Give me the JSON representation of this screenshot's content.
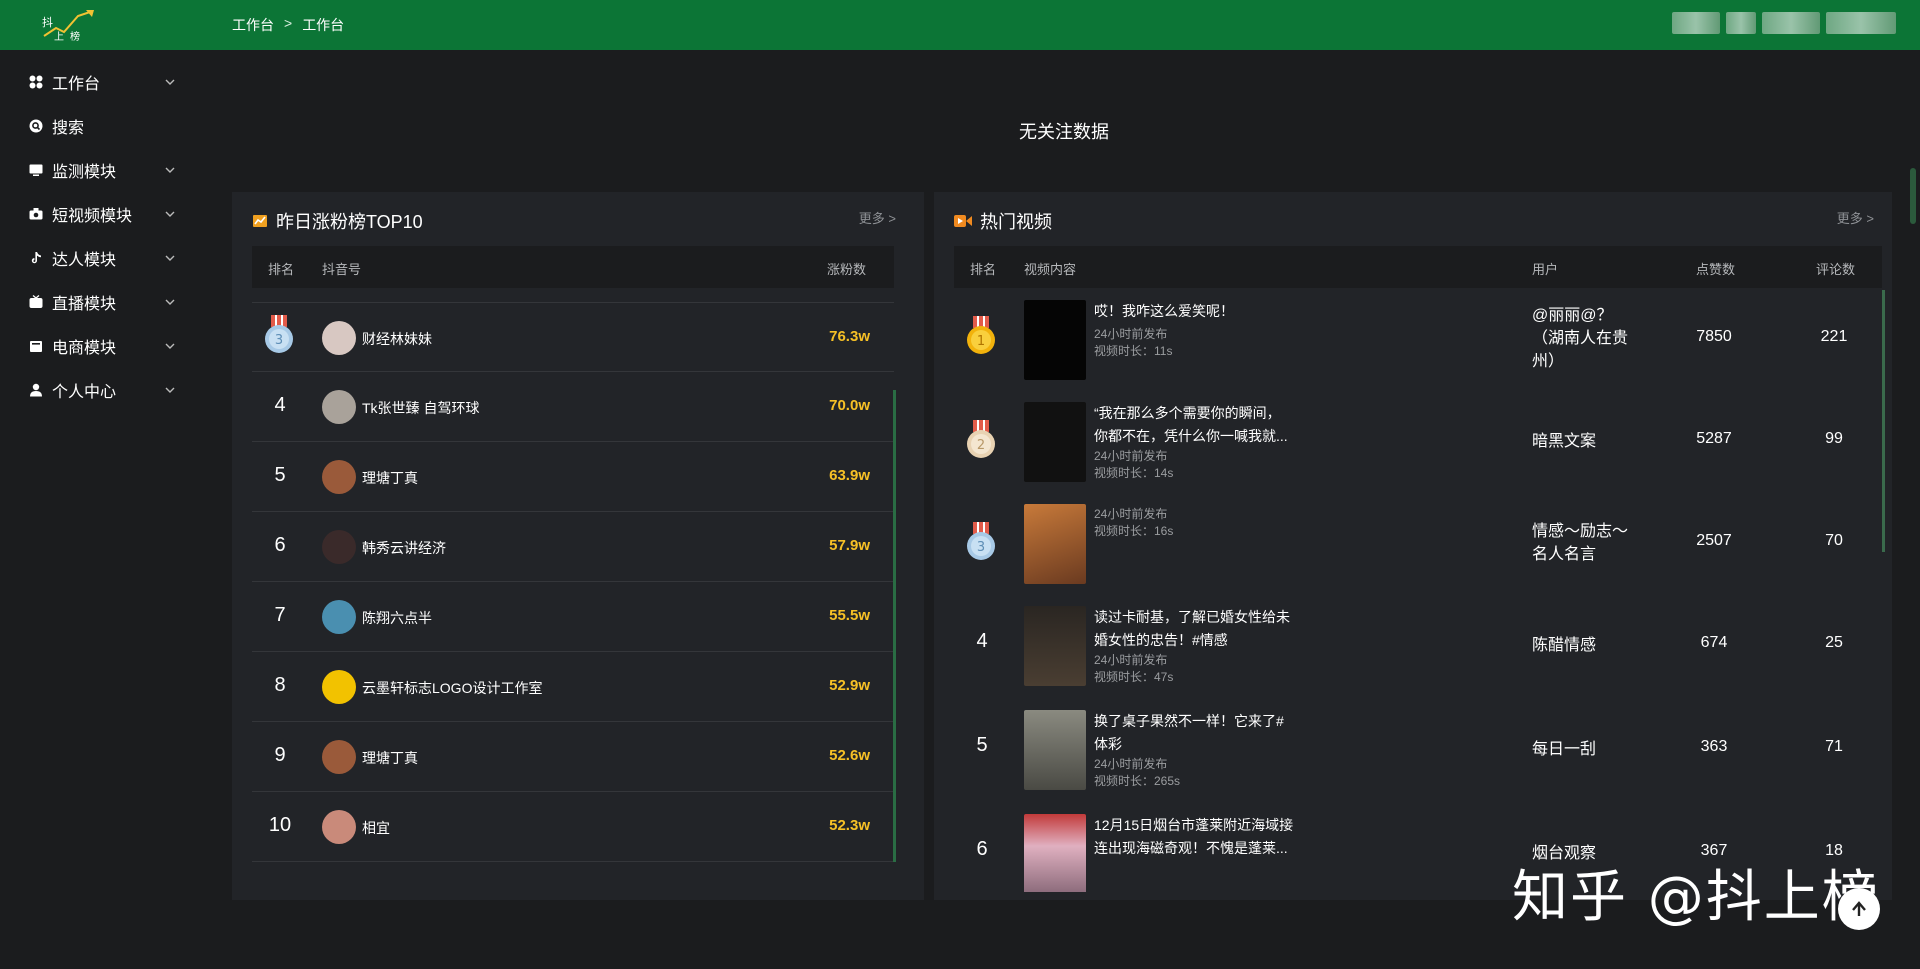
{
  "header": {
    "logo_text": "抖上榜",
    "breadcrumb": [
      "工作台",
      "工作台"
    ],
    "breadcrumb_sep": ">"
  },
  "sidebar": {
    "items": [
      {
        "label": "工作台",
        "icon": "dashboard-icon",
        "has_arrow": true
      },
      {
        "label": "搜索",
        "icon": "search-icon",
        "has_arrow": false
      },
      {
        "label": "监测模块",
        "icon": "monitor-icon",
        "has_arrow": true
      },
      {
        "label": "短视频模块",
        "icon": "camera-icon",
        "has_arrow": true
      },
      {
        "label": "达人模块",
        "icon": "tiktok-icon",
        "has_arrow": true
      },
      {
        "label": "直播模块",
        "icon": "tv-icon",
        "has_arrow": true
      },
      {
        "label": "电商模块",
        "icon": "shop-icon",
        "has_arrow": true
      },
      {
        "label": "个人中心",
        "icon": "user-icon",
        "has_arrow": true
      }
    ]
  },
  "main": {
    "empty_message": "无关注数据"
  },
  "fans_panel": {
    "title": "昨日涨粉榜TOP10",
    "more": "更多 >",
    "headers": {
      "rank": "排名",
      "account": "抖音号",
      "gain": "涨粉数"
    },
    "rows": [
      {
        "rank": "3",
        "medal": true,
        "name": "财经林妹妹",
        "gain": "76.3w",
        "avatar_color": "#d8c8c2"
      },
      {
        "rank": "4",
        "medal": false,
        "name": "Tk张世臻 自驾环球",
        "gain": "70.0w",
        "avatar_color": "#a9a29a"
      },
      {
        "rank": "5",
        "medal": false,
        "name": "理塘丁真",
        "gain": "63.9w",
        "avatar_color": "#9a5a3a"
      },
      {
        "rank": "6",
        "medal": false,
        "name": "韩秀云讲经济",
        "gain": "57.9w",
        "avatar_color": "#3a2a2a"
      },
      {
        "rank": "7",
        "medal": false,
        "name": "陈翔六点半",
        "gain": "55.5w",
        "avatar_color": "#4a8fb0"
      },
      {
        "rank": "8",
        "medal": false,
        "name": "云墨轩标志LOGO设计工作室",
        "gain": "52.9w",
        "avatar_color": "#f2c200"
      },
      {
        "rank": "9",
        "medal": false,
        "name": "理塘丁真",
        "gain": "52.6w",
        "avatar_color": "#9a5a3a"
      },
      {
        "rank": "10",
        "medal": false,
        "name": "相宜",
        "gain": "52.3w",
        "avatar_color": "#c98a7a"
      }
    ]
  },
  "video_panel": {
    "title": "热门视频",
    "more": "更多 >",
    "headers": {
      "rank": "排名",
      "content": "视频内容",
      "user": "用户",
      "likes": "点赞数",
      "comments": "评论数"
    },
    "rows": [
      {
        "rank": "1",
        "medal": "gold",
        "title_lines": [
          "哎！我咋这么爱笑呢！"
        ],
        "published": "24小时前发布",
        "duration": "视频时长：11s",
        "user_lines": [
          "@丽丽@？",
          "（湖南人在贵",
          "州）"
        ],
        "likes": "7850",
        "comments": "221",
        "thumb_color": "#050505"
      },
      {
        "rank": "2",
        "medal": "silver",
        "title_lines": [
          "“我在那么多个需要你的瞬间，",
          "你都不在，凭什么你一喊我就..."
        ],
        "published": "24小时前发布",
        "duration": "视频时长：14s",
        "user_lines": [
          "暗黑文案"
        ],
        "likes": "5287",
        "comments": "99",
        "thumb_color": "#111111"
      },
      {
        "rank": "3",
        "medal": "bronze",
        "title_lines": [],
        "published": "24小时前发布",
        "duration": "视频时长：16s",
        "user_lines": [
          "情感～励志～",
          "名人名言"
        ],
        "likes": "2507",
        "comments": "70",
        "thumb_color": "#a0522d"
      },
      {
        "rank": "4",
        "medal": "",
        "title_lines": [
          "读过卡耐基，了解已婚女性给未",
          "婚女性的忠告！#情感"
        ],
        "published": "24小时前发布",
        "duration": "视频时长：47s",
        "user_lines": [
          "陈醋情感"
        ],
        "likes": "674",
        "comments": "25",
        "thumb_color": "#3a3530"
      },
      {
        "rank": "5",
        "medal": "",
        "title_lines": [
          "换了桌子果然不一样！它来了#",
          "体彩"
        ],
        "published": "24小时前发布",
        "duration": "视频时长：265s",
        "user_lines": [
          "每日一刮"
        ],
        "likes": "363",
        "comments": "71",
        "thumb_color": "#6b6b60"
      },
      {
        "rank": "6",
        "medal": "",
        "title_lines": [
          "12月15日烟台市蓬莱附近海域接",
          "连出现海磁奇观！不愧是蓬莱..."
        ],
        "published": "",
        "duration": "",
        "user_lines": [
          "烟台观察"
        ],
        "likes": "367",
        "comments": "18",
        "thumb_color": "#8a6a7a"
      }
    ]
  },
  "watermark": "知乎 @抖上榜",
  "colors": {
    "header_green": "#0c7536",
    "accent_gold": "#f6c026",
    "panel_bg": "#222428",
    "page_bg": "#1b1c1e"
  }
}
